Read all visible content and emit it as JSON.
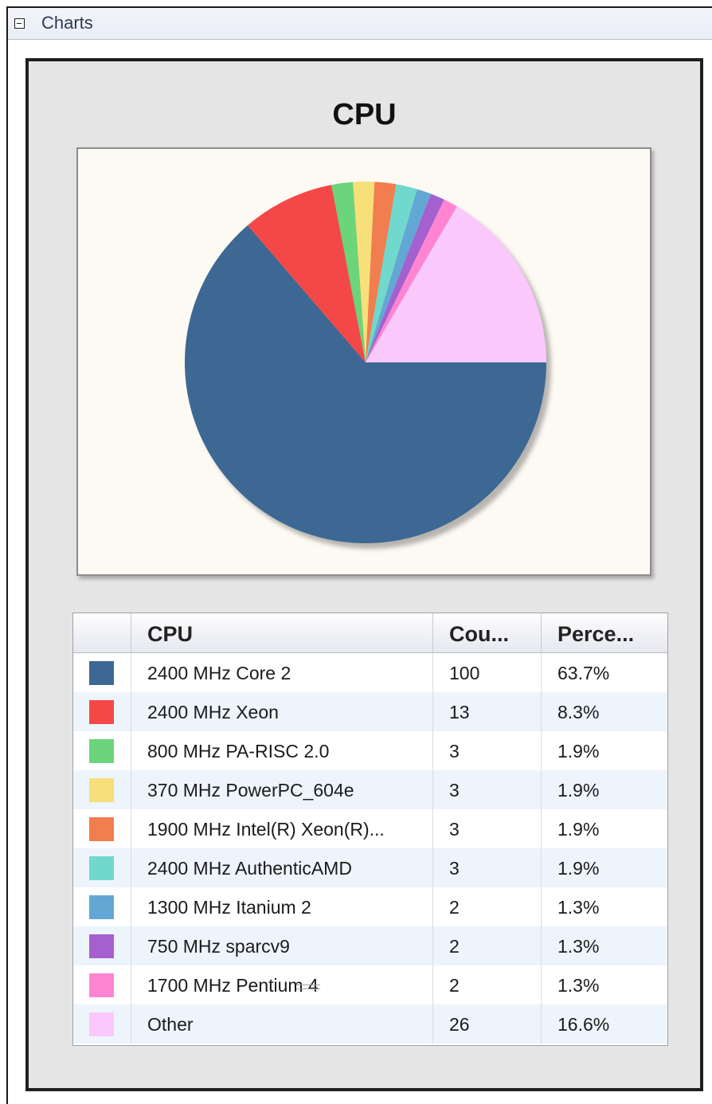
{
  "section": {
    "title": "Charts",
    "toggle_icon": "collapse-minus-icon"
  },
  "table": {
    "headers": [
      "",
      "CPU",
      "Cou...",
      "Perce..."
    ],
    "rows": [
      {
        "name": "2400 MHz Core 2",
        "count": "100",
        "percent": "63.7%"
      },
      {
        "name": "2400 MHz Xeon",
        "count": "13",
        "percent": "8.3%"
      },
      {
        "name": "800 MHz PA-RISC 2.0",
        "count": "3",
        "percent": "1.9%"
      },
      {
        "name": "370 MHz PowerPC_604e",
        "count": "3",
        "percent": "1.9%"
      },
      {
        "name": "1900 MHz Intel(R) Xeon(R)...",
        "count": "3",
        "percent": "1.9%"
      },
      {
        "name": "2400 MHz AuthenticAMD",
        "count": "3",
        "percent": "1.9%"
      },
      {
        "name": "1300 MHz Itanium 2",
        "count": "2",
        "percent": "1.3%"
      },
      {
        "name": "750 MHz sparcv9",
        "count": "2",
        "percent": "1.3%"
      },
      {
        "name": "1700 MHz Pentium 4",
        "count": "2",
        "percent": "1.3%"
      },
      {
        "name": "Other",
        "count": "26",
        "percent": "16.6%"
      }
    ]
  },
  "chart_data": {
    "type": "pie",
    "title": "CPU",
    "categories": [
      "2400 MHz Core 2",
      "2400 MHz Xeon",
      "800 MHz PA-RISC 2.0",
      "370 MHz PowerPC_604e",
      "1900 MHz Intel(R) Xeon(R)...",
      "2400 MHz AuthenticAMD",
      "1300 MHz Itanium 2",
      "750 MHz sparcv9",
      "1700 MHz Pentium 4",
      "Other"
    ],
    "values": [
      100,
      13,
      3,
      3,
      3,
      3,
      2,
      2,
      2,
      26
    ],
    "colors": [
      "#3d6894",
      "#f44848",
      "#6cd47a",
      "#f7df7a",
      "#f27d4e",
      "#70d8cc",
      "#63a7d4",
      "#a560cf",
      "#ff85d3",
      "#fbc8fb"
    ],
    "legend": "table-below",
    "start": "3 o'clock, clockwise"
  }
}
